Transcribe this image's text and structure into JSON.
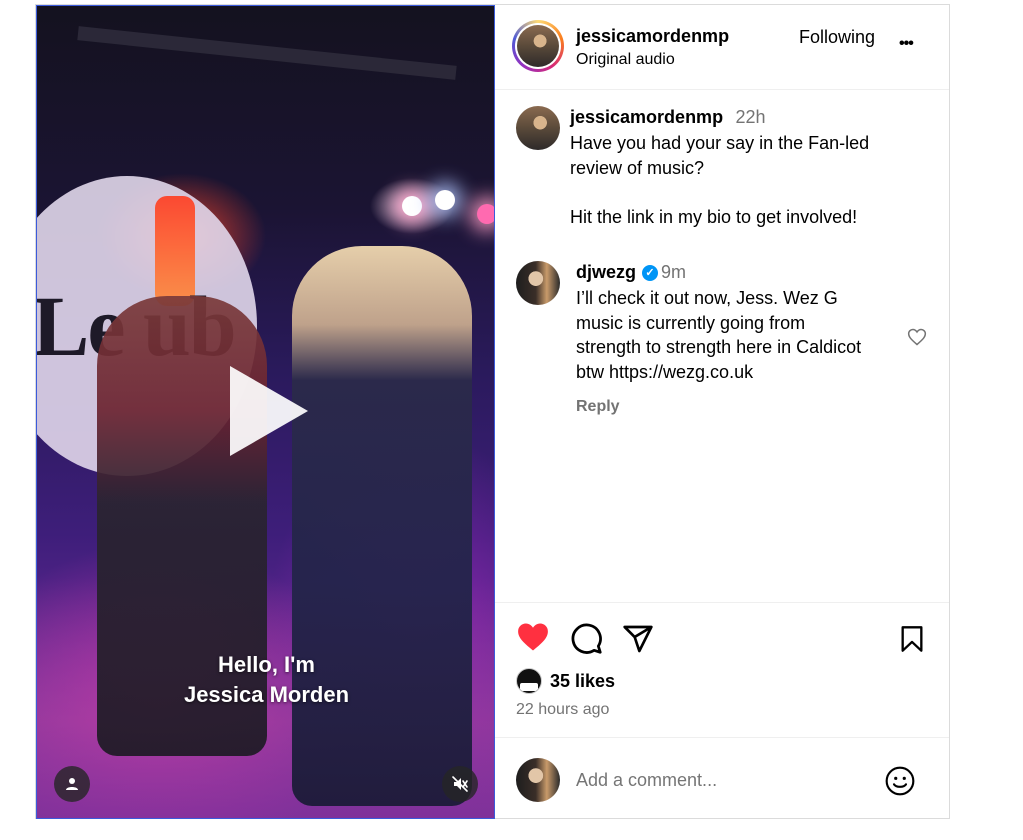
{
  "video": {
    "sign_text": "Le  ub",
    "caption_line1": "Hello, I'm",
    "caption_line2": "Jessica Morden",
    "play_icon": "play-icon",
    "user_icon": "person-icon",
    "mute_icon": "muted-speaker-icon"
  },
  "header": {
    "username": "jessicamordenmp",
    "subtitle": "Original audio",
    "following_label": "Following",
    "more_label": "•••"
  },
  "caption": {
    "username": "jessicamordenmp",
    "time": "22h",
    "line1": "Have you had your say in the Fan-led",
    "line2": "review of music?",
    "line3": "Hit the link in my bio to get involved!"
  },
  "comment": {
    "username": "djwezg",
    "verified_glyph": "✓",
    "time": "9m",
    "lines": [
      "I’ll check it out now, Jess. Wez G",
      "music is currently going from",
      "strength to strength here in Caldicot",
      "btw https://wezg.co.uk"
    ],
    "reply_label": "Reply"
  },
  "actions": {
    "likes": "35 likes",
    "posted": "22 hours ago",
    "like_color": "#ff3040"
  },
  "add_comment": {
    "placeholder": "Add a comment..."
  }
}
